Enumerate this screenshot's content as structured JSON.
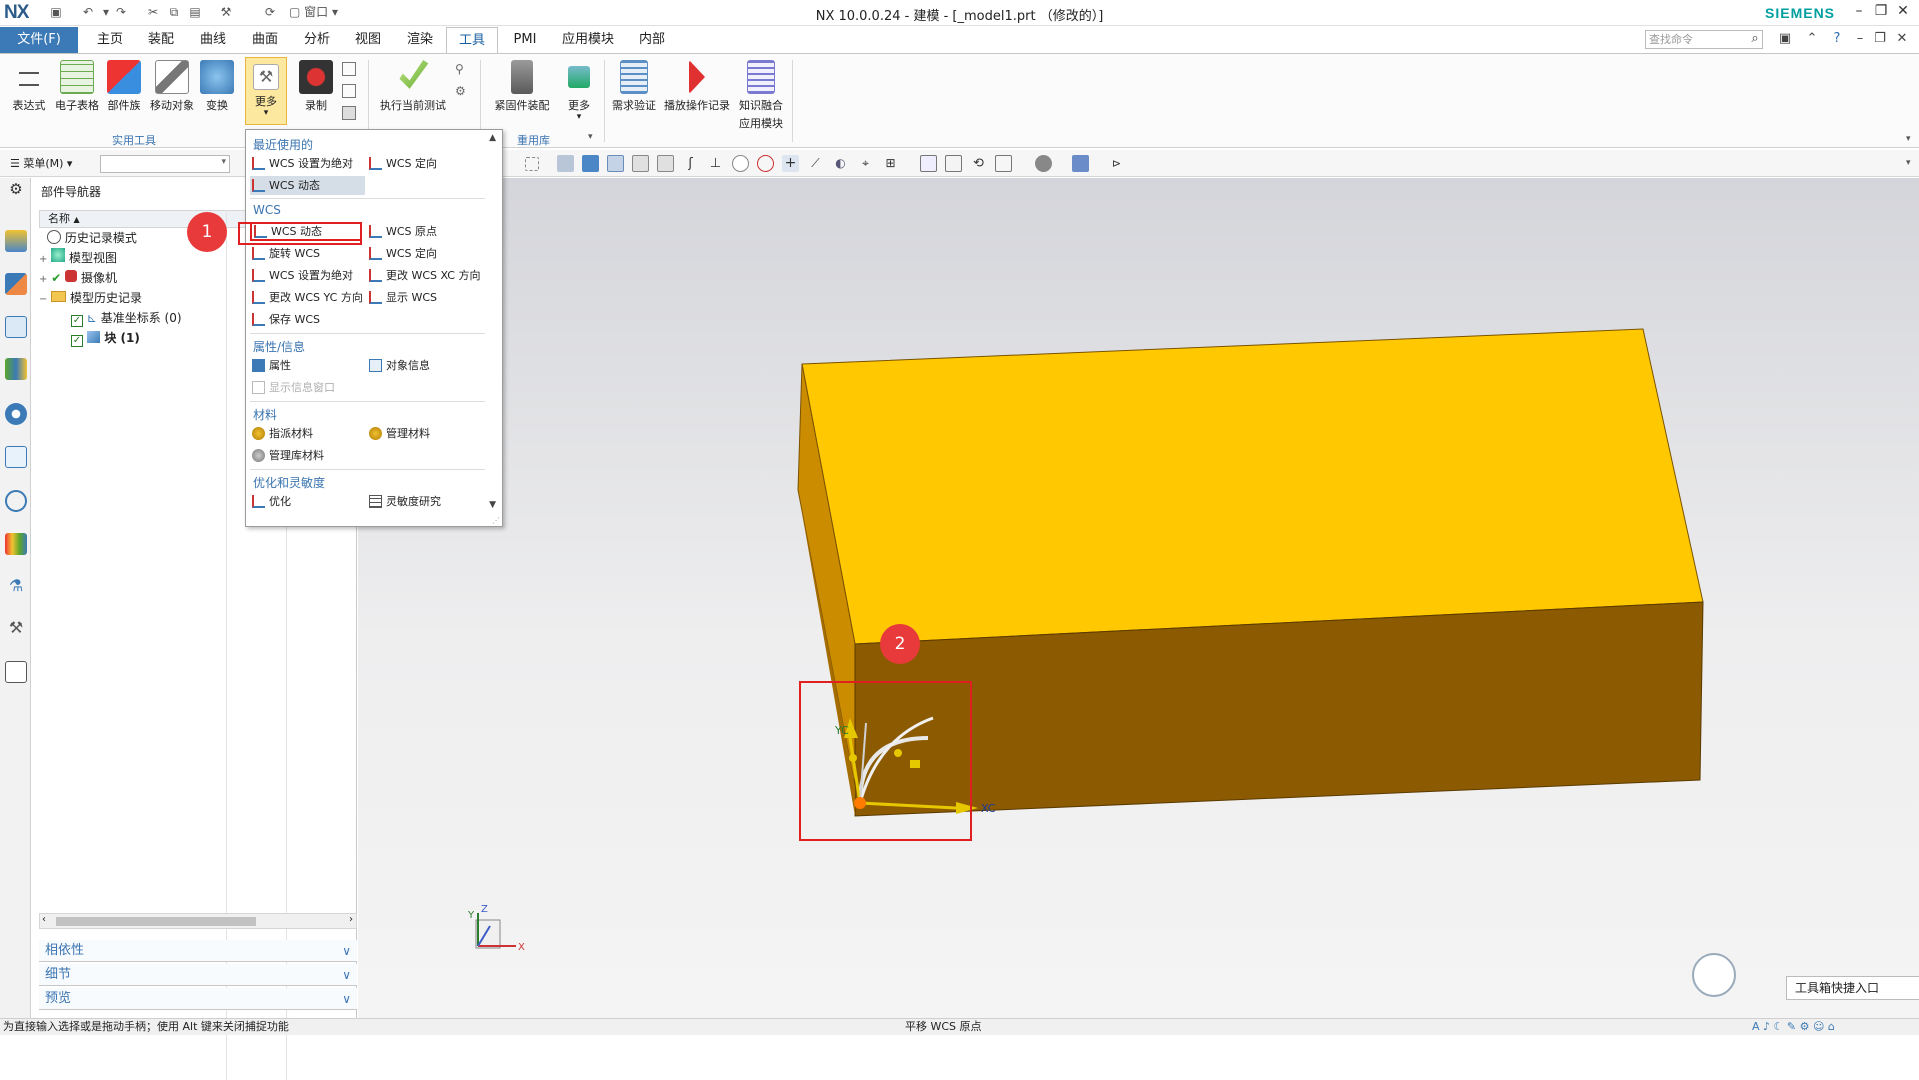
{
  "titlebar": {
    "logo": "NX",
    "title": "NX 10.0.0.24 - 建模 - [_model1.prt （修改的）]",
    "window_menu": "窗口",
    "brand": "SIEMENS"
  },
  "tabs": {
    "file": "文件(F)",
    "items": [
      "主页",
      "装配",
      "曲线",
      "曲面",
      "分析",
      "视图",
      "渲染",
      "工具",
      "PMI",
      "应用模块",
      "内部"
    ],
    "active": "工具"
  },
  "search": {
    "placeholder": "查找命令"
  },
  "ribbon": {
    "buttons": [
      "表达式",
      "电子表格",
      "部件族",
      "移动对象",
      "变换",
      "更多",
      "录制",
      "执行当前测试",
      "紧固件装配",
      "更多",
      "需求验证",
      "播放操作记录",
      "知识融合",
      "应用模块"
    ],
    "groups": {
      "utility": "实用工具",
      "reuse": "重用库"
    }
  },
  "selbar": {
    "menu": "菜单(M)"
  },
  "navigator": {
    "title": "部件导航器",
    "column": "名称",
    "rows": [
      "历史记录模式",
      "模型视图",
      "摄像机",
      "模型历史记录",
      "基准坐标系 (0)",
      "块 (1)"
    ]
  },
  "accordion": [
    "相依性",
    "细节",
    "预览"
  ],
  "dropdown": {
    "sections": {
      "recent": "最近使用的",
      "wcs": "WCS",
      "props": "属性/信息",
      "material": "材料",
      "opt": "优化和灵敏度"
    },
    "recent": [
      "WCS 设置为绝对",
      "WCS 定向",
      "WCS 动态"
    ],
    "wcs": [
      "WCS 动态",
      "WCS 原点",
      "旋转 WCS",
      "WCS 定向",
      "WCS 设置为绝对",
      "更改 WCS XC 方向",
      "更改 WCS YC 方向",
      "显示 WCS",
      "保存 WCS"
    ],
    "props": [
      "属性",
      "对象信息",
      "显示信息窗口"
    ],
    "material": [
      "指派材料",
      "管理材料",
      "管理库材料"
    ],
    "opt": [
      "优化",
      "灵敏度研究"
    ]
  },
  "callouts": [
    "1",
    "2"
  ],
  "triad_labels": {
    "x": "X",
    "y": "Y",
    "z": "Z",
    "xc": "XC",
    "yc": "YC"
  },
  "status": {
    "left": "为直接输入选择或是拖动手柄；使用 Alt 键来关闭捕捉功能",
    "center": "平移 WCS 原点"
  },
  "toolbox": {
    "label": "工具箱快捷入口"
  },
  "colors": {
    "block_top": "#ffc800",
    "block_front": "#8c5a00",
    "block_side": "#cc8c00",
    "accent": "#3b7ab6",
    "highlight": "#e02020"
  }
}
